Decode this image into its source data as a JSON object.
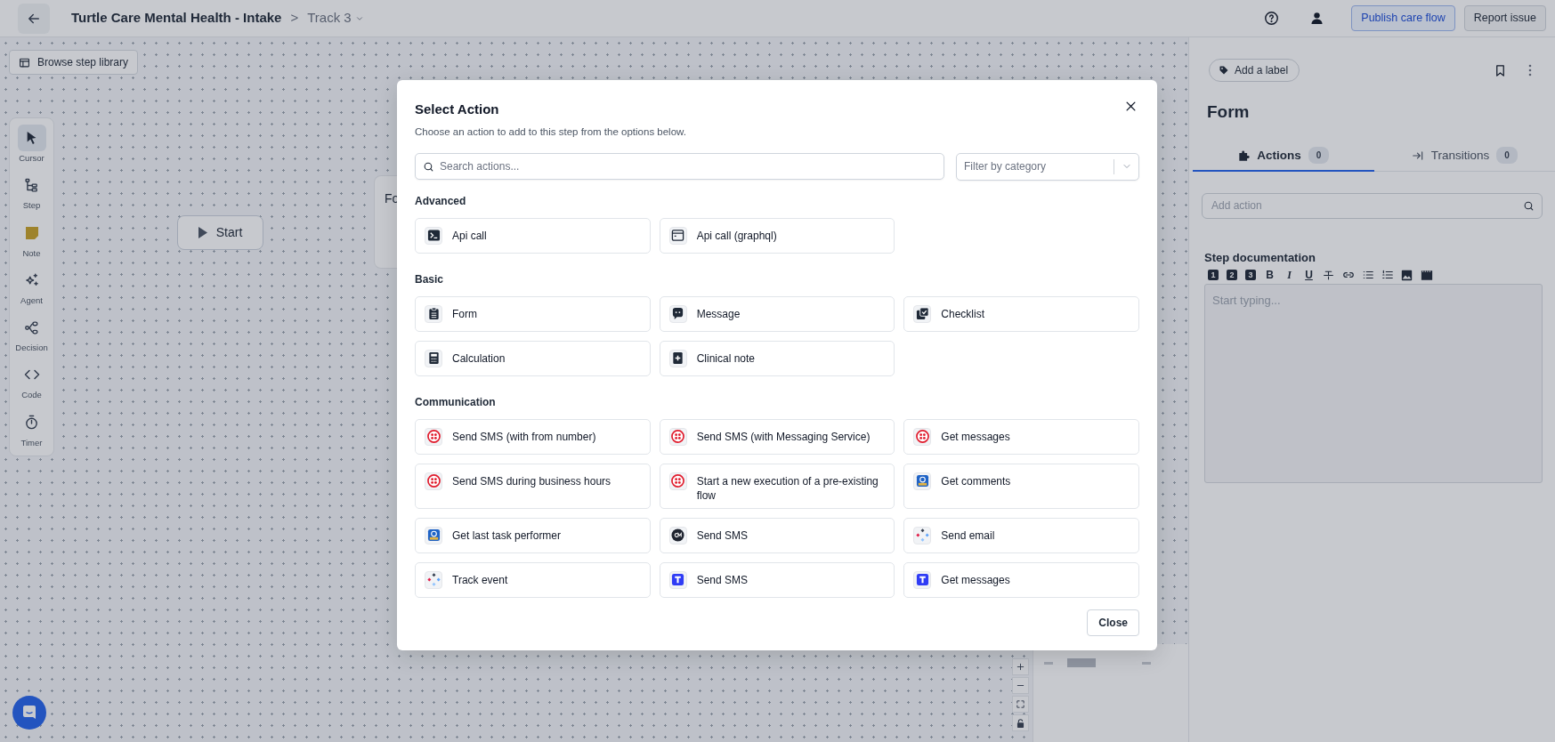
{
  "topbar": {
    "title": "Turtle Care Mental Health - Intake",
    "separator": ">",
    "track": "Track 3",
    "buttons": [
      {
        "label": "Publish care flow",
        "kind": "primary"
      },
      {
        "label": "Report issue",
        "kind": "secondary"
      }
    ]
  },
  "canvas": {
    "library_button": "Browse step library",
    "tools": [
      {
        "label": "Cursor",
        "selected": true
      },
      {
        "label": "Step",
        "selected": false
      },
      {
        "label": "Note",
        "selected": false
      },
      {
        "label": "Agent",
        "selected": false
      },
      {
        "label": "Decision",
        "selected": false
      },
      {
        "label": "Code",
        "selected": false
      },
      {
        "label": "Timer",
        "selected": false
      }
    ],
    "nodes": [
      {
        "kind": "start",
        "label": "Start"
      },
      {
        "kind": "step",
        "label": "Fo"
      }
    ]
  },
  "modal": {
    "title": "Select Action",
    "subtitle": "Choose an action to add to this step from the options below.",
    "search": {
      "placeholder": "Search actions..."
    },
    "filter": {
      "placeholder": "Filter by category"
    },
    "groups": [
      {
        "name": "Advanced",
        "actions": [
          {
            "label": "Api call",
            "kind": "terminal"
          },
          {
            "label": "Api call (graphql)",
            "kind": "browser"
          }
        ]
      },
      {
        "name": "Basic",
        "actions": [
          {
            "label": "Form",
            "kind": "clipboard"
          },
          {
            "label": "Message",
            "kind": "chat"
          },
          {
            "label": "Checklist",
            "kind": "checklist"
          },
          {
            "label": "Calculation",
            "kind": "calculator"
          },
          {
            "label": "Clinical note",
            "kind": "note"
          }
        ]
      },
      {
        "name": "Communication",
        "actions": [
          {
            "label": "Send SMS (with from number)",
            "kind": "red-dots"
          },
          {
            "label": "Send SMS (with Messaging Service)",
            "kind": "red-dots"
          },
          {
            "label": "Get messages",
            "kind": "red-dots"
          },
          {
            "label": "Send SMS during business hours",
            "kind": "red-dots"
          },
          {
            "label": "Start a new execution of a pre-existing flow",
            "kind": "red-dots"
          },
          {
            "label": "Get comments",
            "kind": "blue-badge"
          },
          {
            "label": "Get last task performer",
            "kind": "blue-badge"
          },
          {
            "label": "Send SMS",
            "kind": "dark-circle"
          },
          {
            "label": "Send email",
            "kind": "diamonds"
          },
          {
            "label": "Track event",
            "kind": "diamonds"
          },
          {
            "label": "Send SMS",
            "kind": "blue-t"
          },
          {
            "label": "Get messages",
            "kind": "blue-t"
          }
        ]
      }
    ],
    "close_button": "Close"
  },
  "panel": {
    "label_button": "Add a label",
    "title": "Form",
    "tabs": [
      {
        "label": "Actions",
        "count": "0",
        "selected": true
      },
      {
        "label": "Transitions",
        "count": "0",
        "selected": false
      }
    ],
    "add_action": {
      "placeholder": "Add action"
    },
    "doc_title": "Step documentation",
    "toolbar": [
      {
        "kind": "heading",
        "label": "1"
      },
      {
        "kind": "heading",
        "label": "2"
      },
      {
        "kind": "heading",
        "label": "3"
      },
      {
        "kind": "bold",
        "label": "B"
      },
      {
        "kind": "italic",
        "label": "I"
      },
      {
        "kind": "underline",
        "label": "U"
      },
      {
        "kind": "strike"
      },
      {
        "kind": "link"
      },
      {
        "kind": "bullets"
      },
      {
        "kind": "numbers"
      },
      {
        "kind": "image"
      },
      {
        "kind": "video"
      }
    ],
    "editor": {
      "placeholder": "Start typing..."
    }
  }
}
